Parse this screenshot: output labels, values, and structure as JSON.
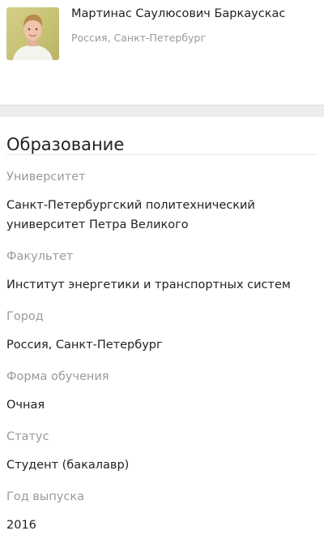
{
  "profile": {
    "name": "Мартинас Саулюсович Баркаускас",
    "location": "Россия, Санкт-Петербург",
    "avatar_icon": "user-photo"
  },
  "education": {
    "title": "Образование",
    "fields": [
      {
        "label": "Университет",
        "value": "Санкт-Петербургский политехнический университет Петра Великого"
      },
      {
        "label": "Факультет",
        "value": "Институт энергетики и транспортных систем"
      },
      {
        "label": "Город",
        "value": "Россия, Санкт-Петербург"
      },
      {
        "label": "Форма обучения",
        "value": "Очная"
      },
      {
        "label": "Статус",
        "value": "Студент (бакалавр)"
      },
      {
        "label": "Год выпуска",
        "value": "2016"
      }
    ]
  },
  "colors": {
    "avatar_background": "#c8c276",
    "label_gray": "#9a9a9a",
    "divider_band": "#ececec"
  }
}
